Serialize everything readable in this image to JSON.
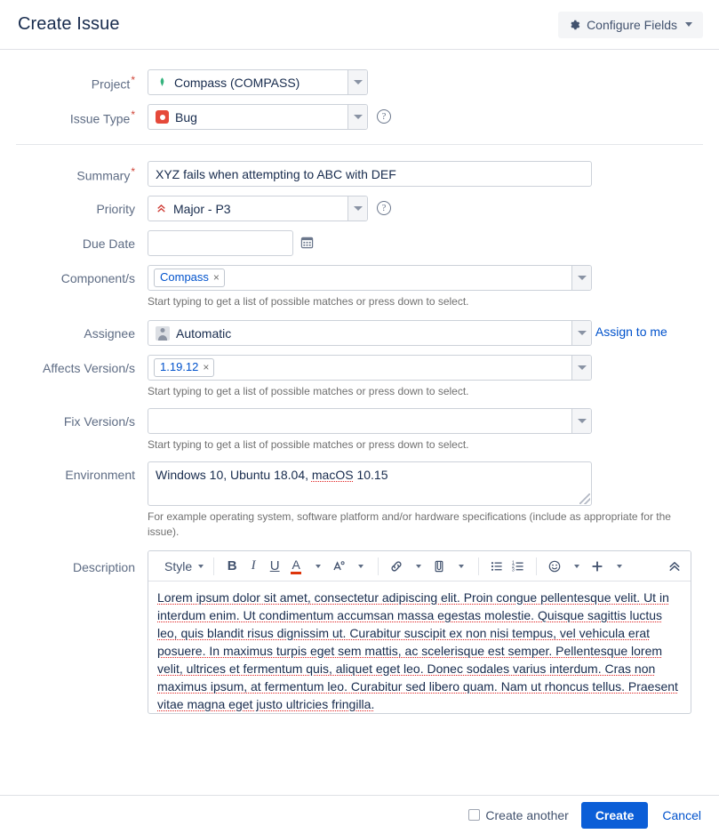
{
  "header": {
    "title": "Create Issue",
    "configure_fields_label": "Configure Fields",
    "gear_icon": "gear-icon",
    "caret_icon": "chevron-down-icon"
  },
  "form": {
    "project": {
      "label": "Project",
      "required": true,
      "value": "Compass  (COMPASS)",
      "icon": "project-leaf-icon"
    },
    "issue_type": {
      "label": "Issue Type",
      "required": true,
      "value": "Bug",
      "icon": "bug-icon",
      "help_icon": "help-circle-icon",
      "help_glyph": "?"
    },
    "summary": {
      "label": "Summary",
      "required": true,
      "value": "XYZ fails when attempting to ABC with DEF",
      "placeholder": ""
    },
    "priority": {
      "label": "Priority",
      "required": false,
      "value": "Major - P3",
      "icon": "priority-major-icon",
      "help_icon": "help-circle-icon",
      "help_glyph": "?"
    },
    "due_date": {
      "label": "Due Date",
      "required": false,
      "value": "",
      "placeholder": "",
      "calendar_icon": "calendar-icon"
    },
    "components": {
      "label": "Component/s",
      "required": false,
      "tags": [
        "Compass"
      ],
      "tag_remove_glyph": "×",
      "help": "Start typing to get a list of possible matches or press down to select."
    },
    "assignee": {
      "label": "Assignee",
      "required": false,
      "value": "Automatic",
      "icon": "user-avatar-icon",
      "assign_to_me_label": "Assign to me"
    },
    "affects_versions": {
      "label": "Affects Version/s",
      "required": false,
      "tags": [
        "1.19.12"
      ],
      "tag_remove_glyph": "×",
      "help": "Start typing to get a list of possible matches or press down to select."
    },
    "fix_versions": {
      "label": "Fix Version/s",
      "required": false,
      "tags": [],
      "value": "",
      "help": "Start typing to get a list of possible matches or press down to select."
    },
    "environment": {
      "label": "Environment",
      "required": false,
      "value_prefix": "Windows 10, Ubuntu 18.04, ",
      "value_misspelled": "macOS",
      "value_suffix": " 10.15",
      "help": "For example operating system, software platform and/or hardware specifications (include as appropriate for the issue)."
    },
    "description": {
      "label": "Description",
      "required": false,
      "toolbar": {
        "style_label": "Style",
        "bold_label": "B",
        "italic_label": "I",
        "underline_label": "U",
        "text_color_label": "A",
        "more_format_label": "A",
        "link_icon": "link-icon",
        "attach_icon": "attachment-icon",
        "bullet_list_icon": "bullet-list-icon",
        "numbered_list_icon": "numbered-list-icon",
        "emoji_icon": "emoji-icon",
        "insert_more_label": "+",
        "collapse_icon": "chevron-double-up-icon"
      },
      "body_text": "Lorem ipsum dolor sit amet, consectetur adipiscing elit. Proin congue pellentesque velit. Ut in interdum enim. Ut condimentum accumsan massa egestas molestie. Quisque sagittis luctus leo, quis blandit risus dignissim ut. Curabitur suscipit ex non nisi tempus, vel vehicula erat posuere. In maximus turpis eget sem mattis, ac scelerisque est semper. Pellentesque lorem velit, ultrices et fermentum quis, aliquet eget leo. Donec sodales varius interdum. Cras non maximus ipsum, at fermentum leo. Curabitur sed libero quam. Nam ut rhoncus tellus. Praesent vitae magna eget justo ultricies fringilla."
    }
  },
  "footer": {
    "create_another_label": "Create another",
    "create_another_checked": false,
    "create_label": "Create",
    "cancel_label": "Cancel"
  },
  "colors": {
    "primary_blue": "#0b5ed7",
    "link_blue": "#0052cc",
    "required_red": "#d04437",
    "bug_red": "#e5493a",
    "priority_red": "#ce3a33",
    "project_green": "#36b37e",
    "label_grey": "#5e6c84",
    "border_grey": "#ccd1d9",
    "spellcheck_red": "#e02020"
  }
}
